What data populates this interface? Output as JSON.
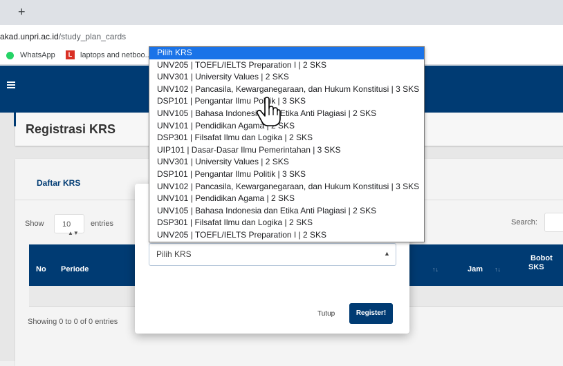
{
  "browser": {
    "new_tab": "+",
    "url_host": "akad.unpri.ac.id",
    "url_path": "/study_plan_cards",
    "bookmarks": [
      {
        "label": "WhatsApp",
        "icon": "whatsapp-icon"
      },
      {
        "label": "laptops and netboo...",
        "icon": "l-bookmark-icon",
        "icon_letter": "L"
      }
    ]
  },
  "page": {
    "title": "Registrasi KRS",
    "list_title": "Daftar KRS",
    "show_label": "Show",
    "entries_value": "10",
    "entries_label": "entries",
    "search_label": "Search:",
    "table": {
      "headers": [
        "No",
        "Periode",
        "Jam",
        "Bobot SKS"
      ],
      "header_bobot_line1": "Bobot",
      "header_bobot_line2": "SKS"
    },
    "showing": "Showing 0 to 0 of 0 entries"
  },
  "modal": {
    "select_value": "Pilih KRS",
    "close_label": "Tutup",
    "register_label": "Register!"
  },
  "dropdown": {
    "selected_index": 0,
    "options": [
      "Pilih KRS",
      "UNV205 | TOEFL/IELTS Preparation I | 2 SKS",
      "UNV301 | University Values | 2 SKS",
      "UNV102 | Pancasila, Kewarganegaraan, dan Hukum Konstitusi | 3 SKS",
      "DSP101 | Pengantar Ilmu Politik | 3 SKS",
      "UNV105 | Bahasa Indonesia dan Etika Anti Plagiasi | 2 SKS",
      "UNV101 | Pendidikan Agama | 2 SKS",
      "DSP301 | Filsafat Ilmu dan Logika | 2 SKS",
      "UIP101 | Dasar-Dasar Ilmu Pemerintahan | 3 SKS",
      "UNV301 | University Values | 2 SKS",
      "DSP101 | Pengantar Ilmu Politik | 3 SKS",
      "UNV102 | Pancasila, Kewarganegaraan, dan Hukum Konstitusi | 3 SKS",
      "UNV101 | Pendidikan Agama | 2 SKS",
      "UNV105 | Bahasa Indonesia dan Etika Anti Plagiasi | 2 SKS",
      "DSP301 | Filsafat Ilmu dan Logika | 2 SKS",
      "UNV205 | TOEFL/IELTS Preparation I | 2 SKS"
    ]
  },
  "colors": {
    "brand_navy": "#003b73",
    "option_highlight": "#1a73e8"
  }
}
